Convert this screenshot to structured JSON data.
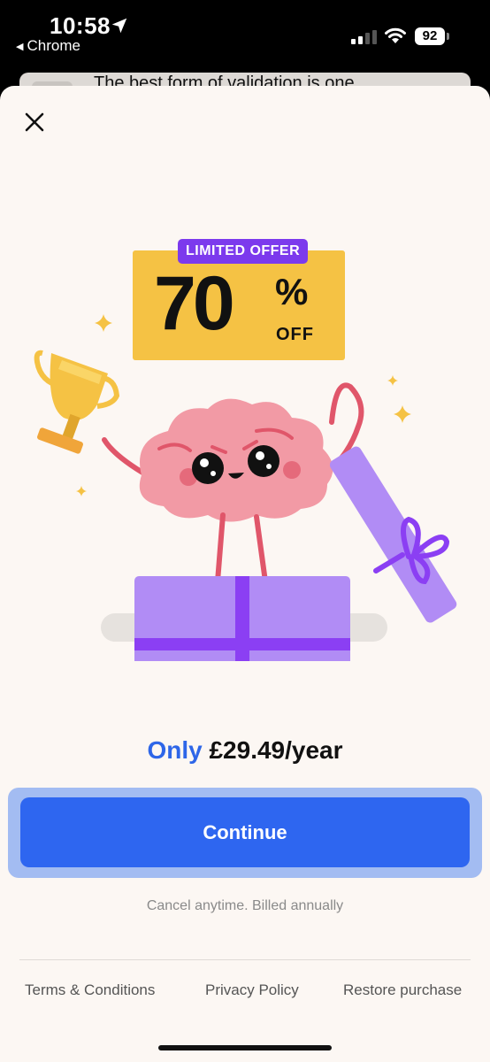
{
  "status_bar": {
    "time": "10:58",
    "back_app": "Chrome",
    "battery": "92"
  },
  "background_page": {
    "text": "The best form of validation is one"
  },
  "offer": {
    "badge": "LIMITED OFFER",
    "discount_number": "70",
    "percent_sign": "%",
    "off_label": "OFF"
  },
  "pricing": {
    "only_label": "Only",
    "price": "£29.49/year"
  },
  "continue_button": {
    "label": "Continue"
  },
  "billing_note": "Cancel anytime. Billed annually",
  "footer": {
    "terms": "Terms & Conditions",
    "privacy": "Privacy Policy",
    "restore": "Restore purchase"
  },
  "colors": {
    "accent_blue": "#2e66f0",
    "badge_purple": "#7c3aed",
    "offer_yellow": "#f5c244",
    "sheet_background": "#fcf7f3"
  },
  "icons": [
    "location-arrow-icon",
    "signal-icon",
    "wifi-icon",
    "battery-icon",
    "close-icon"
  ]
}
